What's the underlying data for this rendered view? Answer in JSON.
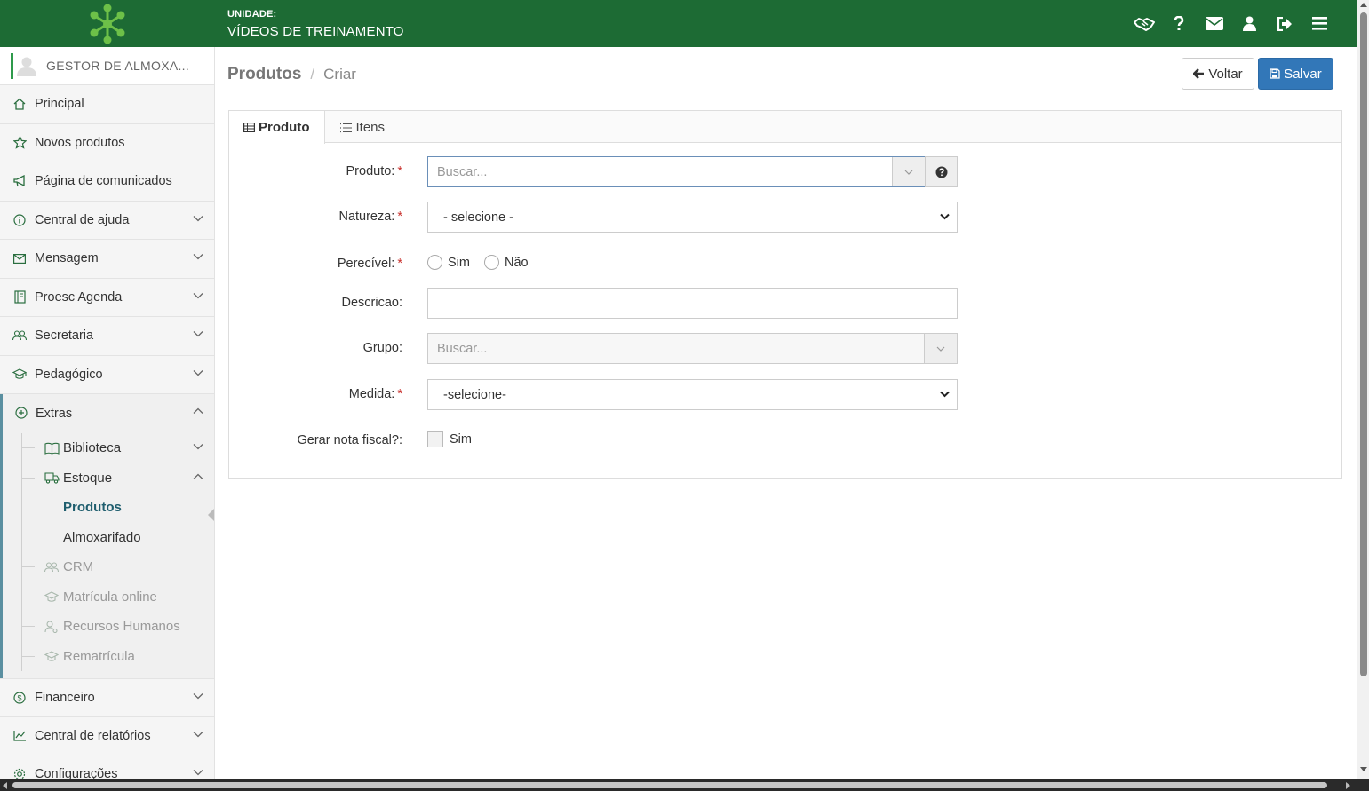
{
  "header": {
    "unit_label": "UNIDADE:",
    "unit_value": "VÍDEOS DE TREINAMENTO",
    "icons": [
      "handshake-icon",
      "question-icon",
      "envelope-icon",
      "user-icon",
      "sign-out-icon",
      "hamburger-menu-icon"
    ],
    "colors": {
      "header_bg": "#1d6b34",
      "logo": "#6dc048"
    }
  },
  "sidebar": {
    "user_name": "GESTOR DE ALMOXA...",
    "items": [
      {
        "label": "Principal",
        "icon": "home-icon"
      },
      {
        "label": "Novos produtos",
        "icon": "star-icon"
      },
      {
        "label": "Página de comunicados",
        "icon": "megaphone-icon"
      },
      {
        "label": "Central de ajuda",
        "icon": "info-icon"
      },
      {
        "label": "Mensagem",
        "icon": "envelope-icon"
      },
      {
        "label": "Proesc Agenda",
        "icon": "agenda-icon"
      },
      {
        "label": "Secretaria",
        "icon": "users-icon"
      },
      {
        "label": "Pedagógico",
        "icon": "graduation-cap-icon"
      }
    ],
    "extras": {
      "label": "Extras",
      "sub": [
        {
          "label": "Biblioteca",
          "icon": "book-icon"
        },
        {
          "label": "Estoque",
          "icon": "truck-icon"
        },
        {
          "label": "CRM",
          "icon": "users-icon"
        },
        {
          "label": "Matrícula online",
          "icon": "graduation-cap-icon"
        },
        {
          "label": "Recursos Humanos",
          "icon": "user-network-icon"
        },
        {
          "label": "Rematrícula",
          "icon": "graduation-cap-icon"
        }
      ],
      "estoque_children": [
        "Produtos",
        "Almoxarifado"
      ]
    },
    "bottom_items": [
      {
        "label": "Financeiro",
        "icon": "dollar-icon"
      },
      {
        "label": "Central de relatórios",
        "icon": "chart-icon"
      },
      {
        "label": "Configurações",
        "icon": "gear-icon"
      }
    ]
  },
  "breadcrumb": {
    "section": "Produtos",
    "separator": "/",
    "page": "Criar"
  },
  "actions": {
    "back_label": "Voltar",
    "save_label": "Salvar",
    "save_color": "#3277b8"
  },
  "tabs": [
    {
      "label": "Produto",
      "icon": "table-icon"
    },
    {
      "label": "Itens",
      "icon": "list-icon"
    }
  ],
  "form": {
    "produto": {
      "label": "Produto:",
      "placeholder": "Buscar...",
      "required": "*"
    },
    "natureza": {
      "label": "Natureza:",
      "value": "- selecione -",
      "required": "*"
    },
    "perecivel": {
      "label": "Perecível:",
      "required": "*",
      "opt_yes": "Sim",
      "opt_no": "Não"
    },
    "descricao": {
      "label": "Descricao:",
      "value": ""
    },
    "grupo": {
      "label": "Grupo:",
      "placeholder": "Buscar..."
    },
    "medida": {
      "label": "Medida:",
      "value": "-selecione-",
      "required": "*"
    },
    "nota_fiscal": {
      "label": "Gerar nota fiscal?:",
      "option": "Sim"
    }
  }
}
